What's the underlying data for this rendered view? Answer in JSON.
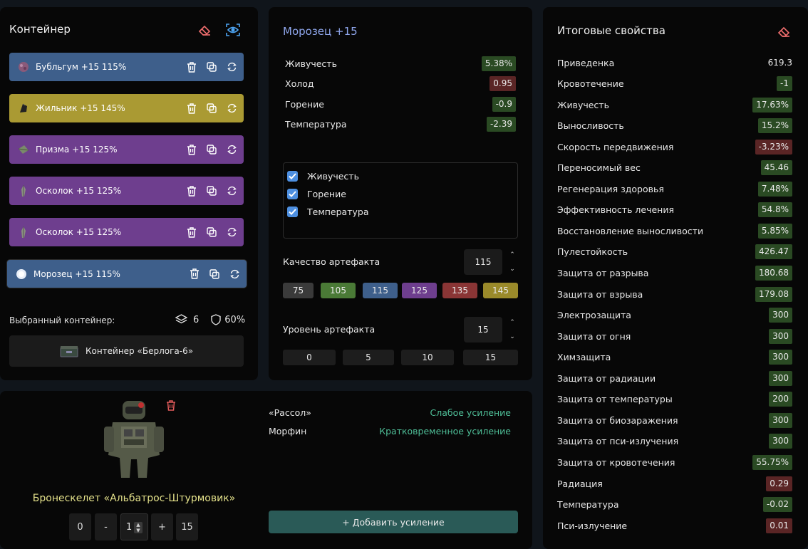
{
  "container": {
    "title": "Контейнер",
    "artifacts": [
      {
        "name": "Бубльгум",
        "level": "+15",
        "quality": "115%",
        "color": "#3e5f8b",
        "icon": "bubblegum-icon"
      },
      {
        "name": "Жильник",
        "level": "+15",
        "quality": "145%",
        "color": "#aa9a33",
        "icon": "zhilnik-icon"
      },
      {
        "name": "Призма",
        "level": "+15",
        "quality": "125%",
        "color": "#6e3e8e",
        "icon": "prism-icon"
      },
      {
        "name": "Осколок",
        "level": "+15",
        "quality": "125%",
        "color": "#6e3e8e",
        "icon": "shard-icon"
      },
      {
        "name": "Осколок",
        "level": "+15",
        "quality": "125%",
        "color": "#6e3e8e",
        "icon": "shard-icon"
      },
      {
        "name": "Морозец",
        "level": "+15",
        "quality": "115%",
        "color": "#3e5f8b",
        "icon": "frost-icon"
      }
    ],
    "selected_label": "Выбранный контейнер:",
    "slots": "6",
    "protection": "60%",
    "container_name": "Контейнер «Берлога-6»"
  },
  "artifact": {
    "title": "Морозец +15",
    "stats": [
      {
        "name": "Живучесть",
        "value": "5.38%",
        "kind": "pos"
      },
      {
        "name": "Холод",
        "value": "0.95",
        "kind": "neg"
      },
      {
        "name": "Горение",
        "value": "-0.9",
        "kind": "pos"
      },
      {
        "name": "Температура",
        "value": "-2.39",
        "kind": "pos"
      }
    ],
    "checks": [
      "Живучесть",
      "Горение",
      "Температура"
    ],
    "quality_label": "Качество артефакта",
    "quality_value": "115",
    "quality_options": [
      {
        "label": "75",
        "color": "#3a3a3a"
      },
      {
        "label": "105",
        "color": "#4a7a36"
      },
      {
        "label": "115",
        "color": "#3e5f8b"
      },
      {
        "label": "125",
        "color": "#6e3e8e"
      },
      {
        "label": "135",
        "color": "#8a3535"
      },
      {
        "label": "145",
        "color": "#9a8a2a"
      }
    ],
    "level_label": "Уровень артефакта",
    "level_value": "15",
    "level_options": [
      "0",
      "5",
      "10",
      "15"
    ]
  },
  "totals": {
    "title": "Итоговые свойства",
    "rows": [
      {
        "name": "Приведенка",
        "value": "619.3",
        "kind": "neu"
      },
      {
        "name": "Кровотечение",
        "value": "-1",
        "kind": "pos"
      },
      {
        "name": "Живучесть",
        "value": "17.63%",
        "kind": "pos"
      },
      {
        "name": "Выносливость",
        "value": "15.2%",
        "kind": "pos"
      },
      {
        "name": "Скорость передвижения",
        "value": "-3.23%",
        "kind": "neg"
      },
      {
        "name": "Переносимый вес",
        "value": "45.46",
        "kind": "pos"
      },
      {
        "name": "Регенерация здоровья",
        "value": "7.48%",
        "kind": "pos"
      },
      {
        "name": "Эффективность лечения",
        "value": "54.8%",
        "kind": "pos"
      },
      {
        "name": "Восстановление выносливости",
        "value": "5.85%",
        "kind": "pos"
      },
      {
        "name": "Пулестойкость",
        "value": "426.47",
        "kind": "pos"
      },
      {
        "name": "Защита от разрыва",
        "value": "180.68",
        "kind": "pos"
      },
      {
        "name": "Защита от взрыва",
        "value": "179.08",
        "kind": "pos"
      },
      {
        "name": "Электрозащита",
        "value": "300",
        "kind": "pos"
      },
      {
        "name": "Защита от огня",
        "value": "300",
        "kind": "pos"
      },
      {
        "name": "Химзащита",
        "value": "300",
        "kind": "pos"
      },
      {
        "name": "Защита от радиации",
        "value": "300",
        "kind": "pos"
      },
      {
        "name": "Защита от температуры",
        "value": "200",
        "kind": "pos"
      },
      {
        "name": "Защита от биозаражения",
        "value": "300",
        "kind": "pos"
      },
      {
        "name": "Защита от пси-излучения",
        "value": "300",
        "kind": "pos"
      },
      {
        "name": "Защита от кровотечения",
        "value": "55.75%",
        "kind": "pos"
      },
      {
        "name": "Радиация",
        "value": "0.29",
        "kind": "neg"
      },
      {
        "name": "Температура",
        "value": "-0.02",
        "kind": "pos"
      },
      {
        "name": "Пси-излучение",
        "value": "0.01",
        "kind": "neg"
      }
    ]
  },
  "suit": {
    "name": "Бронескелет «Альбатрос-Штурмовик»",
    "controls": {
      "min": "0",
      "minus": "-",
      "value": "1",
      "plus": "+",
      "max": "15"
    },
    "boosts": [
      {
        "name": "«Рассол»",
        "effect": "Слабое усиление"
      },
      {
        "name": "Морфин",
        "effect": "Кратковременное усиление"
      }
    ],
    "add_button": "+ Добавить усиление"
  }
}
